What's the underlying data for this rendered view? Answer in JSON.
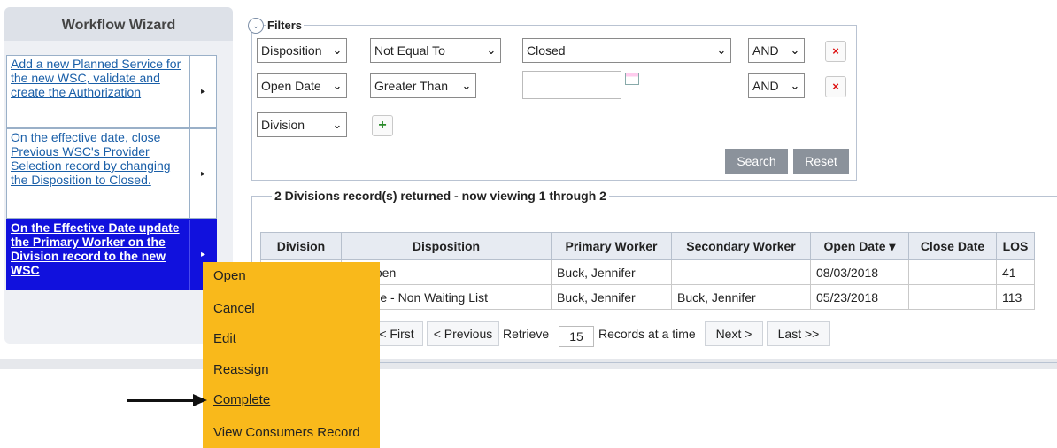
{
  "sidebar": {
    "title": "Workflow Wizard",
    "items": [
      {
        "label": "Add a new Planned Service for the new WSC, validate and create the Authorization",
        "active": false
      },
      {
        "label": "On the effective date, close Previous WSC's Provider Selection record by changing the Disposition to Closed.",
        "active": false
      },
      {
        "label": "On the Effective Date update the Primary Worker on the Division record to the new WSC",
        "active": true
      }
    ],
    "arrow": "▸"
  },
  "filters": {
    "title": "Filters",
    "rows": [
      {
        "field": "Disposition",
        "operator": "Not Equal To",
        "value": "Closed",
        "logic": "AND"
      },
      {
        "field": "Open Date",
        "operator": "Greater Than",
        "value": "",
        "logic": "AND"
      }
    ],
    "add_field": "Division",
    "search_label": "Search",
    "reset_label": "Reset",
    "remove_icon": "×",
    "add_icon": "+"
  },
  "results": {
    "summary": "2 Divisions record(s) returned - now viewing 1 through 2",
    "columns": [
      "Division",
      "Disposition",
      "Primary Worker",
      "Secondary Worker",
      "Open Date ▾",
      "Close Date",
      "LOS"
    ],
    "rows": [
      [
        "",
        "sic Open",
        "Buck, Jennifer",
        "",
        "08/03/2018",
        "",
        "41"
      ],
      [
        "",
        "Eligible - Non Waiting List",
        "Buck, Jennifer",
        "Buck, Jennifer",
        "05/23/2018",
        "",
        "113"
      ]
    ],
    "pager": {
      "first": "First",
      "first_prefix": "<",
      "previous": "< Previous",
      "retrieve": "Retrieve",
      "per_page": "15",
      "records_at_a_time": "Records at a time",
      "next": "Next >",
      "last": "Last >>"
    }
  },
  "context_menu": {
    "items": [
      "Open",
      "Cancel",
      "Edit",
      "Reassign",
      "Complete",
      "View Consumers Record"
    ],
    "highlighted": "Complete",
    "color": "#f9b91b"
  },
  "colors": {
    "accent_blue": "#1111dd",
    "link_blue": "#1a5fa8",
    "button_gray": "#8b929b"
  }
}
